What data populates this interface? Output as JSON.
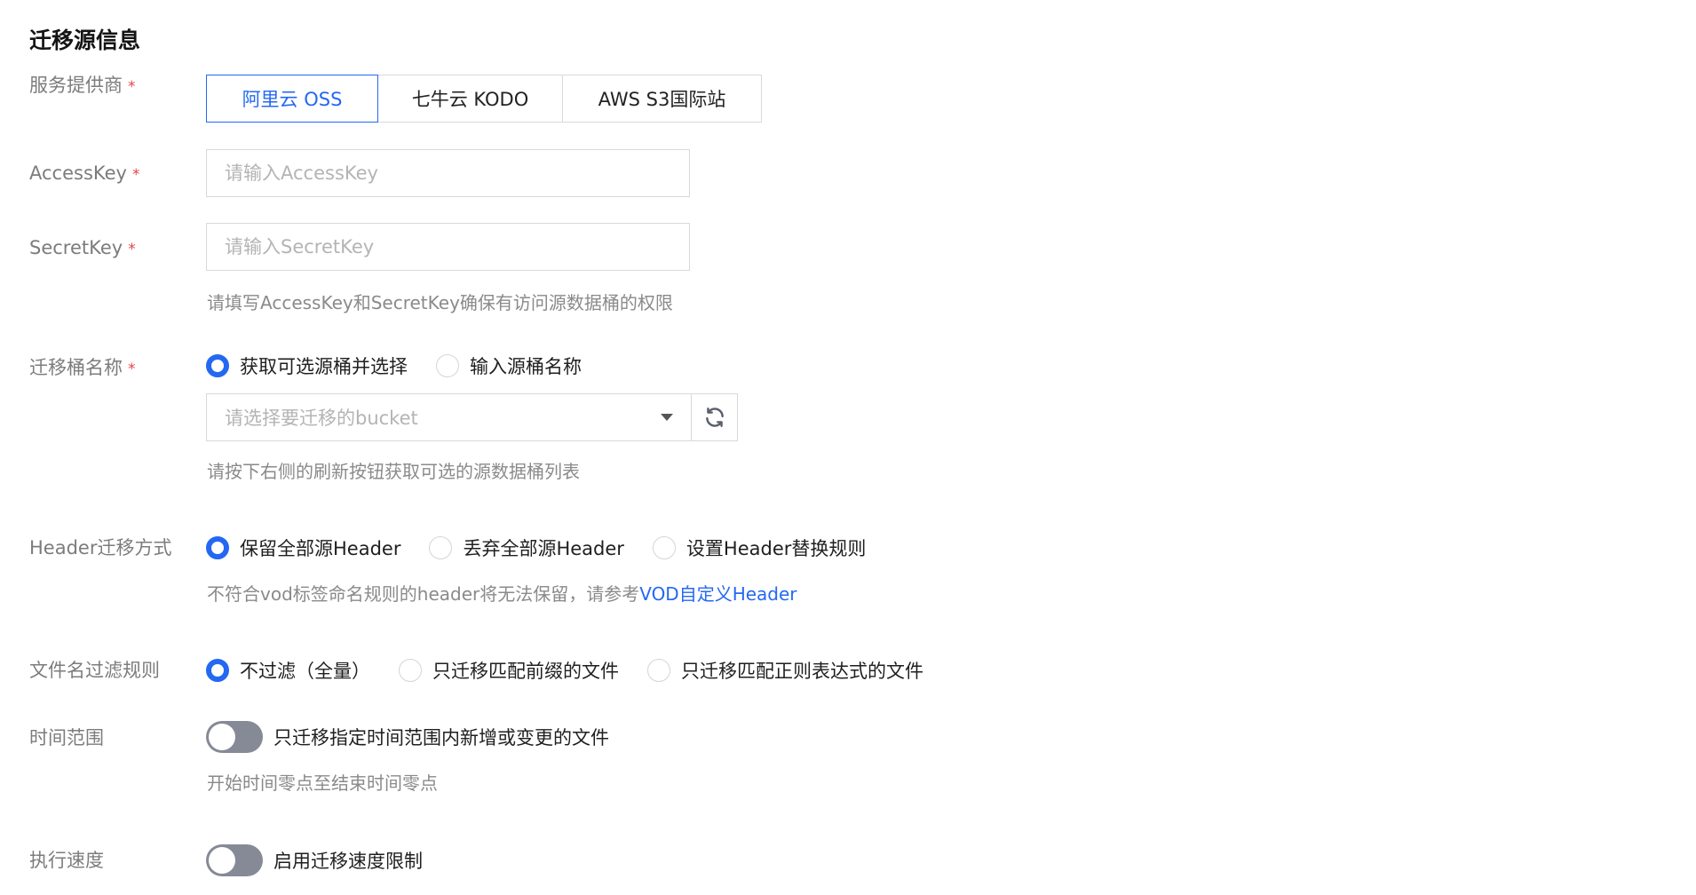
{
  "section_title": "迁移源信息",
  "provider": {
    "label": "服务提供商",
    "required_mark": "*",
    "options": [
      "阿里云 OSS",
      "七牛云 KODO",
      "AWS S3国际站"
    ],
    "selected": "阿里云 OSS"
  },
  "access_key": {
    "label": "AccessKey",
    "required_mark": "*",
    "placeholder": "请输入AccessKey",
    "value": ""
  },
  "secret_key": {
    "label": "SecretKey",
    "required_mark": "*",
    "placeholder": "请输入SecretKey",
    "value": "",
    "hint": "请填写AccessKey和SecretKey确保有访问源数据桶的权限"
  },
  "bucket": {
    "label": "迁移桶名称",
    "required_mark": "*",
    "radio_options": [
      "获取可选源桶并选择",
      "输入源桶名称"
    ],
    "selected_radio": "获取可选源桶并选择",
    "select_placeholder": "请选择要迁移的bucket",
    "hint": "请按下右侧的刷新按钮获取可选的源数据桶列表"
  },
  "header_mode": {
    "label": "Header迁移方式",
    "radio_options": [
      "保留全部源Header",
      "丢弃全部源Header",
      "设置Header替换规则"
    ],
    "selected_radio": "保留全部源Header",
    "hint_text": "不符合vod标签命名规则的header将无法保留，请参考",
    "hint_link": "VOD自定义Header"
  },
  "filename_filter": {
    "label": "文件名过滤规则",
    "radio_options": [
      "不过滤（全量）",
      "只迁移匹配前缀的文件",
      "只迁移匹配正则表达式的文件"
    ],
    "selected_radio": "不过滤（全量）"
  },
  "time_range": {
    "label": "时间范围",
    "toggle_on": false,
    "toggle_text": "只迁移指定时间范围内新增或变更的文件",
    "hint": "开始时间零点至结束时间零点"
  },
  "speed": {
    "label": "执行速度",
    "toggle_on": false,
    "toggle_text": "启用迁移速度限制"
  },
  "colors": {
    "accent": "#2468f2",
    "required": "#e54545",
    "toggle_off": "#868a96"
  }
}
